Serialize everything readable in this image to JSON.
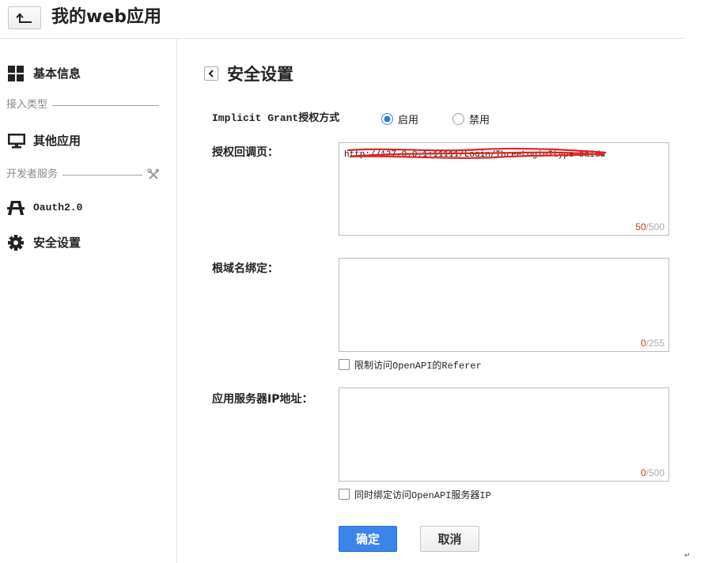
{
  "header": {
    "back_icon": "return-arrow-icon",
    "title": "我的web应用"
  },
  "sidebar": {
    "items": [
      {
        "type": "item",
        "icon": "grid-icon",
        "label": "基本信息"
      },
      {
        "type": "section",
        "label": "接入类型"
      },
      {
        "type": "item",
        "icon": "monitor-icon",
        "label": "其他应用"
      },
      {
        "type": "section",
        "label": "开发者服务",
        "icon": "tools-icon"
      },
      {
        "type": "item",
        "icon": "pylon-icon",
        "label": "Oauth2.0"
      },
      {
        "type": "item",
        "icon": "gear-icon",
        "label": "安全设置",
        "active": true
      }
    ]
  },
  "main": {
    "back_icon": "chevron-left-icon",
    "title": "安全设置",
    "implicit_grant": {
      "label": "Implicit Grant授权方式",
      "options": [
        {
          "label": "启用",
          "checked": true
        },
        {
          "label": "禁用",
          "checked": false
        }
      ]
    },
    "callback": {
      "label": "授权回调页：",
      "value": "http://127.0.0.1:11111/Login/ThreeLogin?type=baidu",
      "count": "50",
      "max": "/500"
    },
    "root_domain": {
      "label": "根域名绑定：",
      "value": "",
      "count": "0",
      "max": "/255",
      "checkbox": {
        "label": "限制访问OpenAPI的Referer",
        "checked": false
      }
    },
    "server_ip": {
      "label": "应用服务器IP地址：",
      "value": "",
      "count": "0",
      "max": "/500",
      "checkbox": {
        "label": "同时绑定访问OpenAPI服务器IP",
        "checked": false
      }
    },
    "buttons": {
      "confirm": "确定",
      "cancel": "取消"
    }
  },
  "footer_mark": "↵",
  "colors": {
    "accent": "#3b84e8",
    "counter_current": "#c0392b",
    "counter_max": "#aaaaaa",
    "redaction": "#e02424"
  }
}
